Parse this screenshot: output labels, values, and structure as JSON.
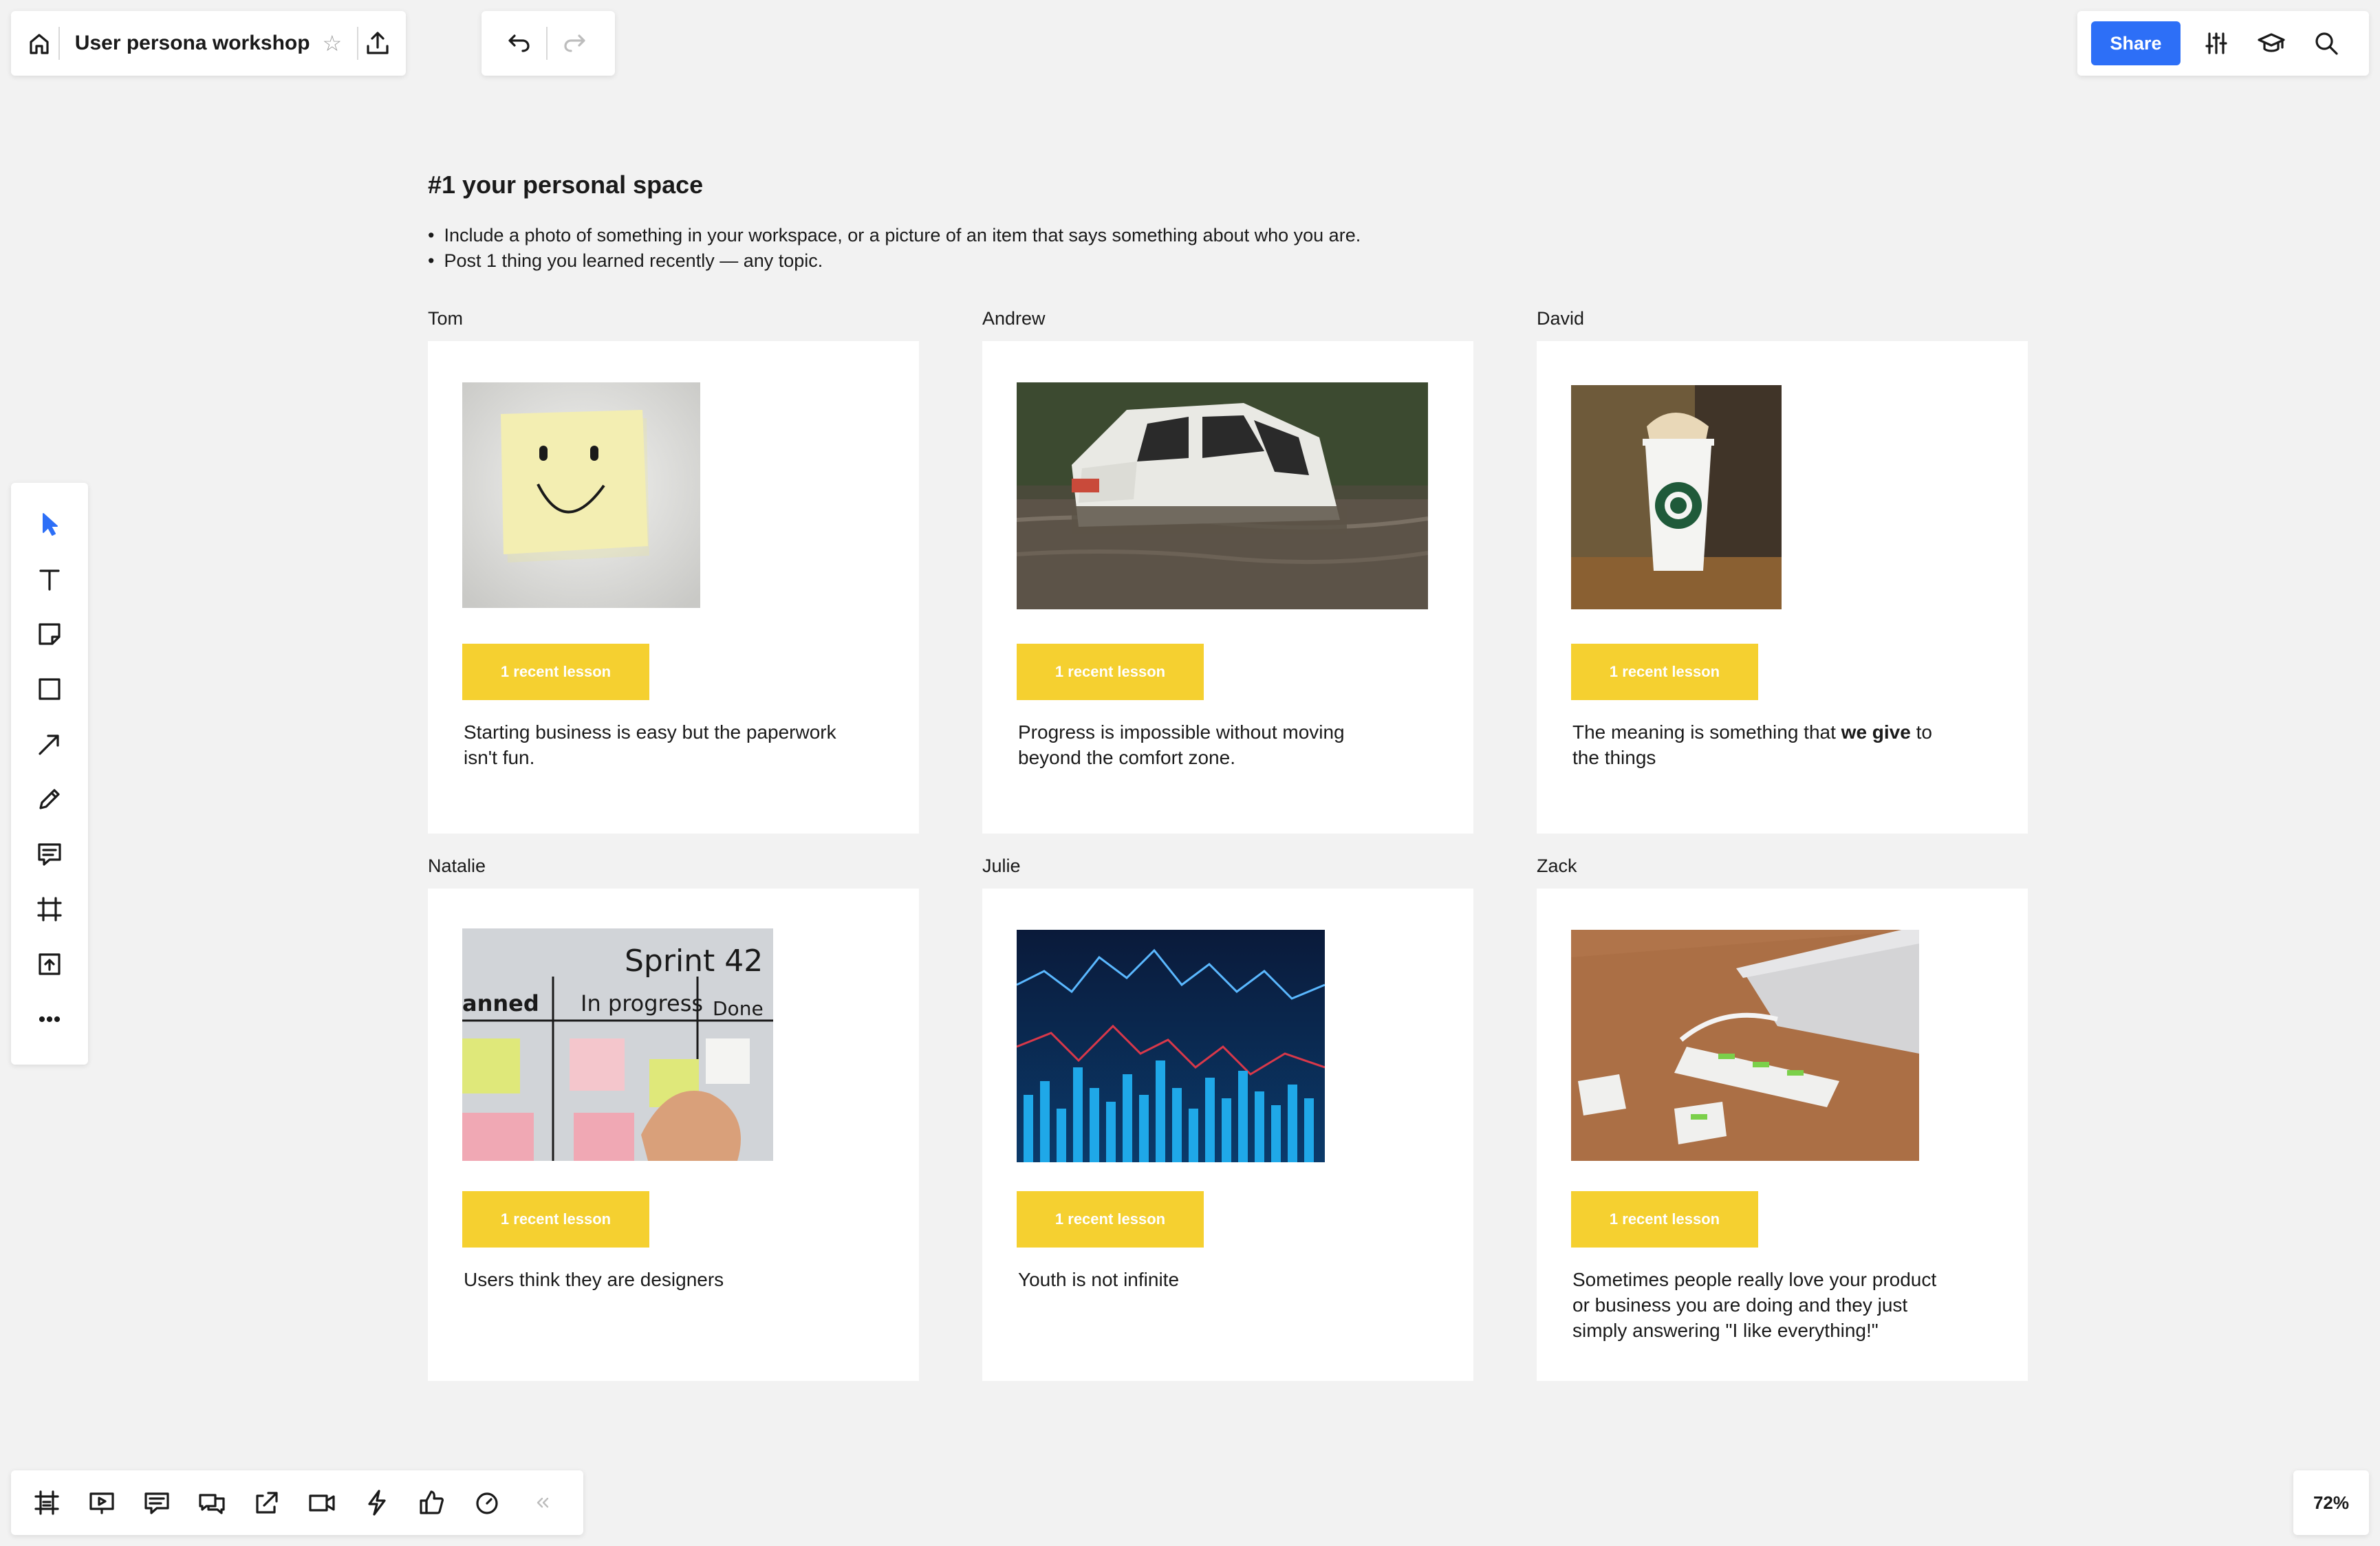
{
  "header": {
    "board_title": "User persona workshop",
    "share_label": "Share"
  },
  "frame": {
    "title": "#1 your personal space",
    "instructions": [
      "Include a photo of something in your workspace, or a picture of an item that says something about who you are.",
      "Post 1 thing you learned recently — any topic."
    ]
  },
  "cards": [
    {
      "name": "Tom",
      "tag": "1 recent lesson",
      "lesson": "Starting business is easy but the paperwork isn't fun.",
      "photo": "sticky-note-smiley"
    },
    {
      "name": "Andrew",
      "tag": "1 recent lesson",
      "lesson": "Progress is impossible without moving beyond the comfort zone.",
      "photo": "suv-in-flood"
    },
    {
      "name": "David",
      "tag": "1 recent lesson",
      "lesson_before": "The meaning is something that ",
      "lesson_bold": "we give",
      "lesson_after": " to the things",
      "photo": "coffee-cup"
    },
    {
      "name": "Natalie",
      "tag": "1 recent lesson",
      "lesson": "Users think they are designers",
      "photo": "sprint-board",
      "photo_text": {
        "title": "Sprint 42",
        "col1": "anned",
        "col2": "In progress",
        "col3": "Done"
      }
    },
    {
      "name": "Julie",
      "tag": "1 recent lesson",
      "lesson": "Youth is not infinite",
      "photo": "stock-chart"
    },
    {
      "name": "Zack",
      "tag": "1 recent lesson",
      "lesson": "Sometimes people really love your product or business you are doing and they just simply answering \"I like everything!\"",
      "photo": "laptop-usb-hub"
    }
  ],
  "toolbar_left": [
    "cursor-icon",
    "text-icon",
    "sticky-note-icon",
    "rectangle-icon",
    "arrow-icon",
    "pen-icon",
    "comment-icon",
    "frame-icon",
    "upload-icon",
    "more-icon"
  ],
  "toolbar_bottom": [
    "frames-icon",
    "presentation-icon",
    "comments-icon",
    "chat-icon",
    "share-screen-icon",
    "video-icon",
    "lightning-icon",
    "like-icon",
    "timer-icon",
    "collapse-icon"
  ],
  "zoom": {
    "level": "72%"
  },
  "colors": {
    "accent": "#2d6ff7",
    "tag": "#f5d030",
    "canvas": "#f2f2f2"
  }
}
